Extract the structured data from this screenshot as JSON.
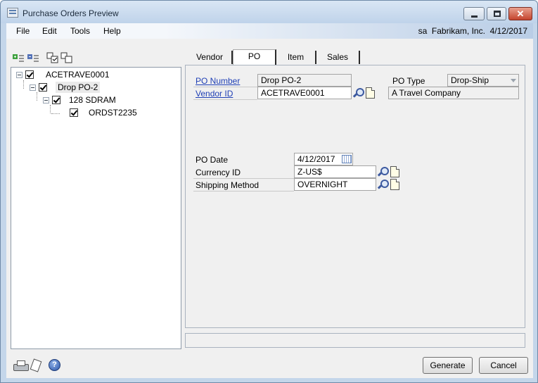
{
  "window": {
    "title": "Purchase Orders Preview"
  },
  "menu": {
    "items": [
      "File",
      "Edit",
      "Tools",
      "Help"
    ],
    "company": "sa  Fabrikam, Inc.  4/12/2017"
  },
  "tree": {
    "nodes": [
      {
        "label": "ACETRAVE0001",
        "checked": true
      },
      {
        "label": "Drop PO-2",
        "checked": true,
        "selected": true
      },
      {
        "label": "128 SDRAM",
        "checked": true
      },
      {
        "label": "ORDST2235",
        "checked": true
      }
    ]
  },
  "tabs": [
    "Vendor",
    "PO",
    "Item",
    "Sales"
  ],
  "active_tab": "PO",
  "form": {
    "po_number_label": "PO Number",
    "po_number": "Drop PO-2",
    "vendor_id_label": "Vendor ID",
    "vendor_id": "ACETRAVE0001",
    "po_type_label": "PO Type",
    "po_type": "Drop-Ship",
    "vendor_name": "A Travel Company",
    "po_date_label": "PO Date",
    "po_date": "4/12/2017",
    "currency_id_label": "Currency ID",
    "currency_id": "Z-US$",
    "shipping_method_label": "Shipping Method",
    "shipping_method": "OVERNIGHT"
  },
  "buttons": {
    "generate": "Generate",
    "cancel": "Cancel"
  },
  "icons": {
    "toolbar": [
      "expand-all-icon",
      "collapse-all-icon",
      "check-all-icon",
      "uncheck-all-icon"
    ],
    "bottom": [
      "printer-icon",
      "document-icon",
      "help-icon"
    ]
  },
  "help_glyph": "?",
  "colors": {
    "link": "#1f3fb5",
    "window_frame": "#c4d6ea",
    "close_button": "#c4442d"
  }
}
